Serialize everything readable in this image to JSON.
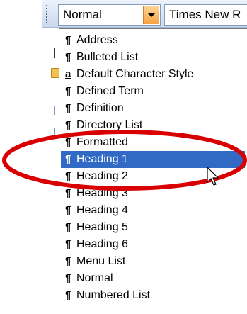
{
  "toolbar": {
    "style_combo_value": "Normal",
    "font_combo_value": "Times New R"
  },
  "style_list": {
    "items": [
      {
        "mark": "¶",
        "label": "Address"
      },
      {
        "mark": "¶",
        "label": "Bulleted List"
      },
      {
        "mark": "a",
        "label": "Default Character Style"
      },
      {
        "mark": "¶",
        "label": "Defined Term"
      },
      {
        "mark": "¶",
        "label": "Definition"
      },
      {
        "mark": "¶",
        "label": "Directory List"
      },
      {
        "mark": "¶",
        "label": "Formatted"
      },
      {
        "mark": "¶",
        "label": "Heading 1"
      },
      {
        "mark": "¶",
        "label": "Heading 2"
      },
      {
        "mark": "¶",
        "label": "Heading 3"
      },
      {
        "mark": "¶",
        "label": "Heading 4"
      },
      {
        "mark": "¶",
        "label": "Heading 5"
      },
      {
        "mark": "¶",
        "label": "Heading 6"
      },
      {
        "mark": "¶",
        "label": "Menu List"
      },
      {
        "mark": "¶",
        "label": "Normal"
      },
      {
        "mark": "¶",
        "label": "Numbered List"
      }
    ],
    "selected_label": "Heading 1"
  },
  "colors": {
    "selection": "#316ac5",
    "highlight_ellipse": "#d80000",
    "dropdown_button": "#f7a23f"
  },
  "icons": {
    "combo_arrow": "chevron-down-icon",
    "cursor": "mouse-pointer-icon",
    "gutter": "folder-icon"
  }
}
